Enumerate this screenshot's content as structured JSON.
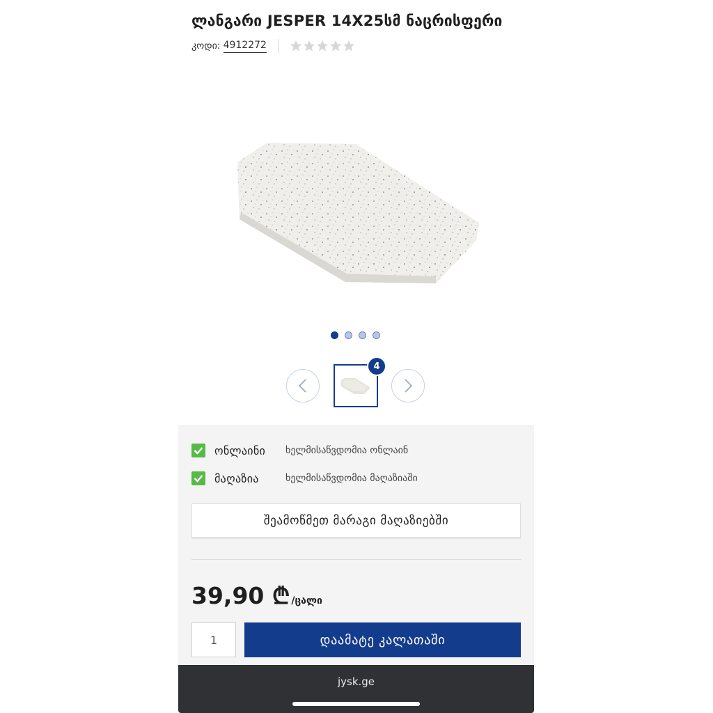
{
  "product": {
    "title": "ლანგარი JESPER 14X25სმ ნაცრისფერი",
    "code_label": "კოდი:",
    "code_value": "4912272",
    "rating_value": 0,
    "rating_max": 5
  },
  "gallery": {
    "dot_count": 4,
    "active_dot": 0,
    "image_count_badge": "4",
    "prev_icon": "chevron-left-icon",
    "next_icon": "chevron-right-icon"
  },
  "availability": {
    "items": [
      {
        "label": "ონლაინი",
        "text": "ხელმისაწვდომია ონლაინ"
      },
      {
        "label": "მაღაზია",
        "text": "ხელმისაწვდომია მაღაზიაში"
      }
    ],
    "check_stores_label": "შეამოწმეთ მარაგი მაღაზიებში"
  },
  "pricing": {
    "price": "39,90 ₾",
    "unit": "/ცალი"
  },
  "cart": {
    "quantity": "1",
    "add_label": "დაამატე კალათაში"
  },
  "browser": {
    "url": "jysk.ge"
  },
  "colors": {
    "brand_blue": "#143c8c",
    "check_green": "#58b947",
    "browser_bar": "#2f3134"
  }
}
